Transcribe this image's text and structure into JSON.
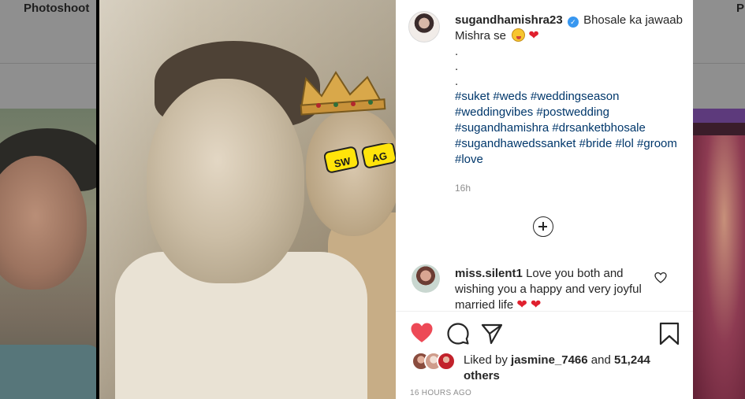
{
  "background": {
    "left_label": "Photoshoot",
    "right_label": "P"
  },
  "post": {
    "owner": {
      "username": "sugandhamishra23",
      "verified": true
    },
    "caption": {
      "text": "Bhosale ka jawaab Mishra se",
      "emojis": [
        "zany-face",
        "red-heart"
      ],
      "dots": [
        ".",
        ".",
        "."
      ],
      "hashtags": [
        "#suket",
        "#weds",
        "#weddingseason",
        "#weddingvibes",
        "#postwedding",
        "#sugandhamishra",
        "#drsanketbhosale",
        "#sugandhawedssanket",
        "#bride",
        "#lol",
        "#groom",
        "#love"
      ]
    },
    "time_ago": "16h",
    "media_overlay_text": [
      "SW",
      "AG"
    ],
    "comments": [
      {
        "username": "miss.silent1",
        "text": "Love you both and wishing you a happy and very joyful married life",
        "emojis": [
          "red-heart",
          "red-heart"
        ]
      }
    ],
    "actions": {
      "like": "heart-icon",
      "comment": "comment-icon",
      "share": "share-icon",
      "save": "bookmark-icon",
      "add_comment": "add-icon"
    },
    "likes": {
      "prefix": "Liked by",
      "user": "jasmine_7466",
      "connector": "and",
      "others": "51,244 others"
    },
    "date": "16 HOURS AGO"
  },
  "colors": {
    "hashtag": "#00376b",
    "like_red": "#ed4956",
    "muted": "#8e8e8e",
    "verified": "#3897f0"
  }
}
